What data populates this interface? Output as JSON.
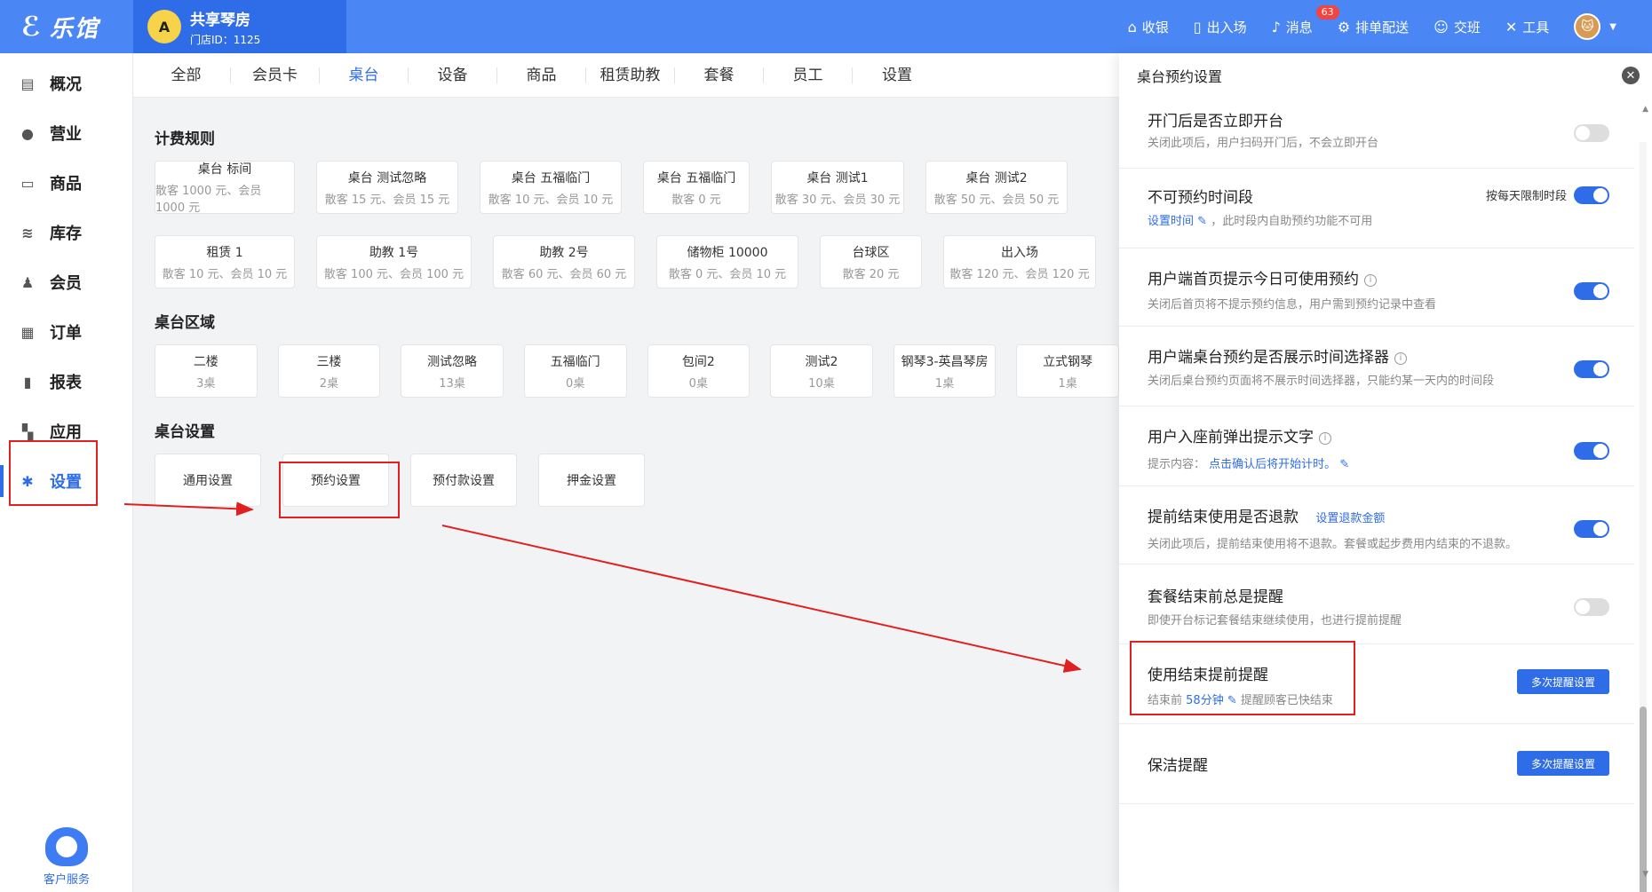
{
  "app": {
    "logo_text": "乐馆"
  },
  "store": {
    "name": "共享琴房",
    "id_text": "门店ID：1125",
    "avatar_letter": "A"
  },
  "top_actions": [
    {
      "label": "收银",
      "icon": "cashier-icon"
    },
    {
      "label": "出入场",
      "icon": "door-icon"
    },
    {
      "label": "消息",
      "icon": "bell-icon",
      "badge": "63"
    },
    {
      "label": "排单配送",
      "icon": "delivery-icon"
    },
    {
      "label": "交班",
      "icon": "shift-icon"
    },
    {
      "label": "工具",
      "icon": "tools-icon"
    }
  ],
  "sidebar": {
    "items": [
      {
        "label": "概况",
        "icon": "chart-icon"
      },
      {
        "label": "营业",
        "icon": "bag-icon"
      },
      {
        "label": "商品",
        "icon": "cart-icon"
      },
      {
        "label": "库存",
        "icon": "layers-icon"
      },
      {
        "label": "会员",
        "icon": "user-icon"
      },
      {
        "label": "订单",
        "icon": "order-icon"
      },
      {
        "label": "报表",
        "icon": "bar-chart-icon"
      },
      {
        "label": "应用",
        "icon": "apps-icon"
      },
      {
        "label": "设置",
        "icon": "gear-icon",
        "active": true
      }
    ],
    "service_label": "客户服务"
  },
  "tabs": [
    "全部",
    "会员卡",
    "桌台",
    "设备",
    "商品",
    "租赁助教",
    "套餐",
    "员工",
    "设置"
  ],
  "active_tab": "桌台",
  "billing": {
    "title": "计费规则",
    "row1": [
      {
        "name": "桌台 标间",
        "sub": "散客 1000 元、会员 1000 元"
      },
      {
        "name": "桌台 测试忽略",
        "sub": "散客 15 元、会员 15 元"
      },
      {
        "name": "桌台 五福临门",
        "sub": "散客 10 元、会员 10 元"
      },
      {
        "name": "桌台 五福临门",
        "sub": "散客 0 元"
      },
      {
        "name": "桌台 测试1",
        "sub": "散客 30 元、会员 30 元"
      },
      {
        "name": "桌台 测试2",
        "sub": "散客 50 元、会员 50 元"
      }
    ],
    "row2": [
      {
        "name": "租赁 1",
        "sub": "散客 10 元、会员 10 元"
      },
      {
        "name": "助教 1号",
        "sub": "散客 100 元、会员 100 元"
      },
      {
        "name": "助教 2号",
        "sub": "散客 60 元、会员 60 元"
      },
      {
        "name": "储物柜 10000",
        "sub": "散客 0 元、会员 10 元"
      },
      {
        "name": "台球区",
        "sub": "散客 20 元"
      },
      {
        "name": "出入场",
        "sub": "散客 120 元、会员 120 元"
      }
    ]
  },
  "areas": {
    "title": "桌台区域",
    "items": [
      {
        "name": "二楼",
        "count": "3桌"
      },
      {
        "name": "三楼",
        "count": "2桌"
      },
      {
        "name": "测试忽略",
        "count": "13桌"
      },
      {
        "name": "五福临门",
        "count": "0桌"
      },
      {
        "name": "包间2",
        "count": "0桌"
      },
      {
        "name": "测试2",
        "count": "10桌"
      },
      {
        "name": "钢琴3-英昌琴房",
        "count": "1桌"
      },
      {
        "name": "立式钢琴",
        "count": "1桌"
      }
    ]
  },
  "table_settings": {
    "title": "桌台设置",
    "items": [
      "通用设置",
      "预约设置",
      "预付款设置",
      "押金设置"
    ]
  },
  "drawer": {
    "title": "桌台预约设置",
    "settings": [
      {
        "title": "开门后是否立即开台",
        "desc": "关闭此项后，用户扫码开门后，不会立即开台",
        "toggle": false
      },
      {
        "title": "不可预约时间段",
        "link": "设置时间",
        "desc": "，此时段内自助预约功能不可用",
        "toggle_label": "按每天限制时段",
        "toggle": true
      },
      {
        "title": "用户端首页提示今日可使用预约",
        "desc": "关闭后首页将不提示预约信息，用户需到预约记录中查看",
        "toggle": true,
        "info": true
      },
      {
        "title": "用户端桌台预约是否展示时间选择器",
        "desc": "关闭后桌台预约页面将不展示时间选择器，只能约某一天内的时间段",
        "toggle": true,
        "info": true
      },
      {
        "title": "用户入座前弹出提示文字",
        "desc_prefix": "提示内容：",
        "link": "点击确认后将开始计时。",
        "toggle": true,
        "info": true
      },
      {
        "title": "提前结束使用是否退款",
        "title_link": "设置退款金额",
        "desc": "关闭此项后，提前结束使用将不退款。套餐或起步费用内结束的不退款。",
        "toggle": true
      },
      {
        "title": "套餐结束前总是提醒",
        "desc": "即使开台标记套餐结束继续使用，也进行提前提醒",
        "toggle": false
      },
      {
        "title": "使用结束提前提醒",
        "desc_prefix": "结束前",
        "link": "58分钟",
        "desc_suffix": "提醒顾客已快结束",
        "button": "多次提醒设置"
      },
      {
        "title": "保洁提醒",
        "button": "多次提醒设置"
      }
    ]
  },
  "colors": {
    "primary": "#2f6de8",
    "topbar": "#4a86f4",
    "annotation": "#e02020"
  }
}
